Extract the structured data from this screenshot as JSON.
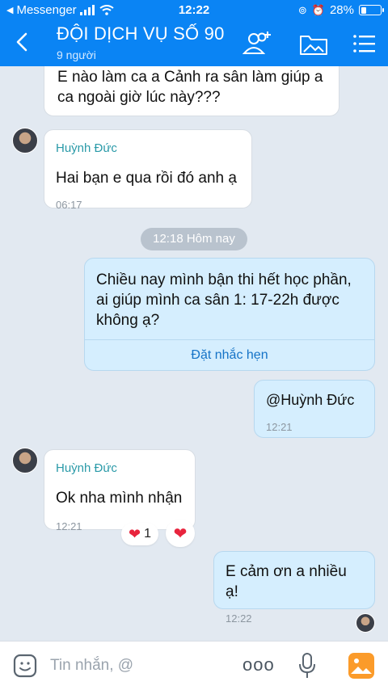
{
  "status_bar": {
    "app_back": "Messenger",
    "time": "12:22",
    "battery": "28%"
  },
  "header": {
    "title": "ĐỘI DỊCH VỤ SỐ 90",
    "members": "9 người"
  },
  "messages": [
    {
      "text": "E nào làm ca a Cảnh ra sân làm giúp a ca ngoài giờ lúc này???"
    },
    {
      "sender": "Huỳnh Đức",
      "text": "Hai bạn e qua rồi đó anh ạ",
      "time": "06:17"
    },
    {
      "divider": "12:18 Hôm nay"
    },
    {
      "text": "Chiều nay mình bận thi hết học phần, ai giúp mình ca sân 1: 17-22h được không ạ?",
      "action": "Đặt nhắc hẹn"
    },
    {
      "text": "@Huỳnh Đức",
      "time": "12:21"
    },
    {
      "sender": "Huỳnh Đức",
      "text": "Ok nha mình nhận",
      "time": "12:21",
      "reaction_count": "1"
    },
    {
      "text": "E cảm ơn a nhiều ạ!",
      "time": "12:22"
    }
  ],
  "input": {
    "placeholder": "Tin nhắn, @",
    "more": "ooo"
  },
  "colors": {
    "header_blue": "#0a84f4",
    "my_bubble": "#d5eefe",
    "chat_bg": "#e2e9f1",
    "heart": "#e8243d"
  }
}
